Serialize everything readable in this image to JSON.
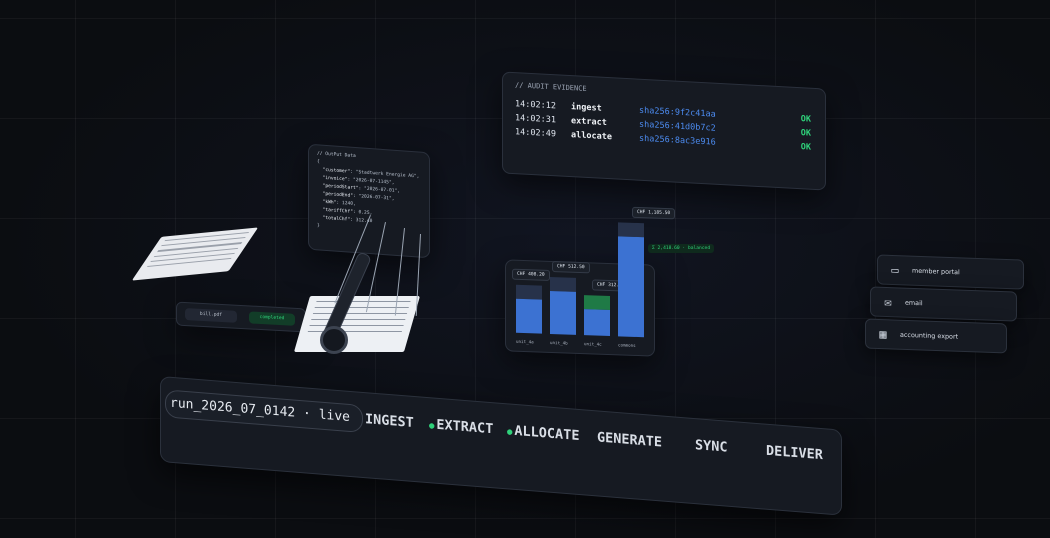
{
  "audit": {
    "header": "// AUDIT EVIDENCE",
    "rows": [
      {
        "time": "14:02:12",
        "step": "ingest",
        "hash": "sha256:9f2c41aa",
        "status": "OK"
      },
      {
        "time": "14:02:31",
        "step": "extract",
        "hash": "sha256:41d0b7c2",
        "status": "OK"
      },
      {
        "time": "14:02:49",
        "step": "allocate",
        "hash": "sha256:8ac3e916",
        "status": "OK"
      }
    ]
  },
  "json_doc": {
    "header": "// OutPut Data",
    "open": "{",
    "lines": [
      {
        "key": "\"customer\"",
        "value": ": \"Stadtwerk Energie AG\","
      },
      {
        "key": "\"invoice\"",
        "value": ": \"2026-07-1145\","
      },
      {
        "key": "\"periodStart\"",
        "value": ": \"2026-07-01\","
      },
      {
        "key": "\"periodEnd\"",
        "value": ": \"2026-07-31\","
      },
      {
        "key": "\"kWh\"",
        "value": ": 1240,"
      },
      {
        "key": "\"tariffChf\"",
        "value": ": 0.25,"
      },
      {
        "key": "\"totalChf\"",
        "value": ": 312.40"
      }
    ],
    "close": "}"
  },
  "chips": {
    "file": "bill.pdf",
    "status": "completed"
  },
  "chart_data": {
    "type": "bar",
    "categories": [
      "unit_4a",
      "unit_4b",
      "unit_4c",
      "commons"
    ],
    "values": [
      408.2,
      512.5,
      312.4,
      1185.5
    ],
    "labels": [
      "CHF 408.20",
      "CHF 512.50",
      "CHF 312.40",
      "CHF 1,185.50"
    ],
    "note": "Σ 2,418.60 · balanced",
    "colors": {
      "bar": "#3c72d2",
      "highlight": "#1f7a46"
    }
  },
  "channels": [
    {
      "icon": "browser-icon",
      "label": "member portal"
    },
    {
      "icon": "mail-icon",
      "label": "email"
    },
    {
      "icon": "grid-icon",
      "label": "accounting export"
    }
  ],
  "pipeline": {
    "run": "run_2026_07_0142 · live",
    "stages": [
      {
        "label": "INGEST",
        "active": false
      },
      {
        "label": "EXTRACT",
        "active": true
      },
      {
        "label": "ALLOCATE",
        "active": true
      },
      {
        "label": "GENERATE",
        "active": false
      },
      {
        "label": "SYNC",
        "active": false
      },
      {
        "label": "DELIVER",
        "active": false
      }
    ]
  },
  "colors": {
    "ok": "#2fd17a",
    "hash": "#4c8bf0",
    "background": "#0b0d11"
  }
}
